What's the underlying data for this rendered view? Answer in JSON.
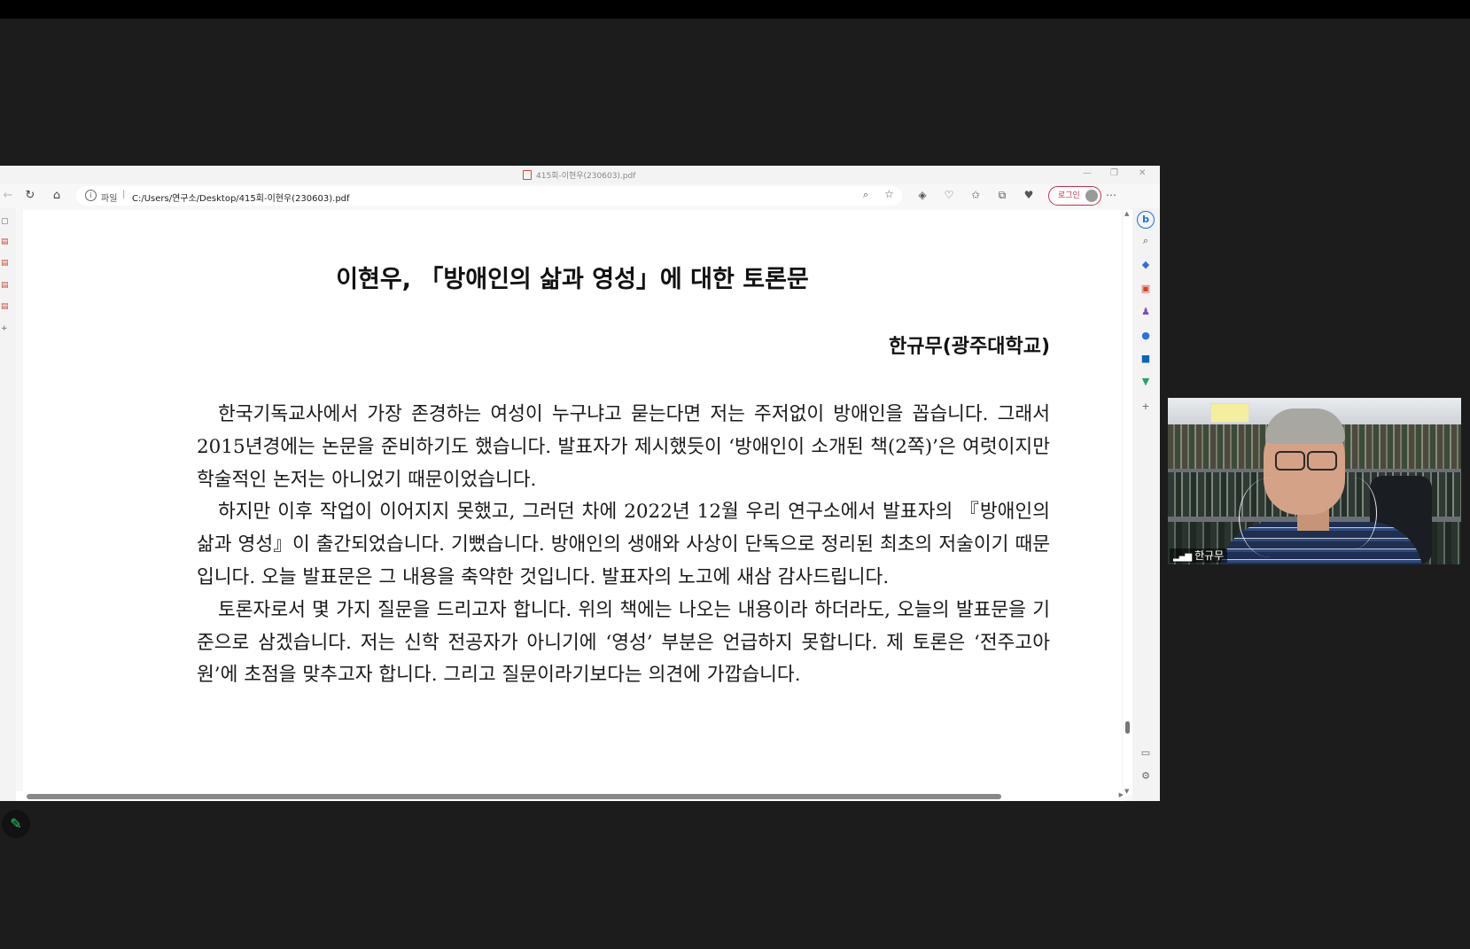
{
  "browser": {
    "tab_title": "415회-이현우(230603).pdf",
    "win_controls": {
      "minimize": "—",
      "restore": "❐",
      "close": "✕"
    },
    "address": {
      "scheme": "파일",
      "separator": "|",
      "url": "C:/Users/연구소/Desktop/415회-이현우(230603).pdf"
    },
    "login_label": "로그인"
  },
  "document": {
    "title": "이현우, 「방애인의 삶과 영성」에 대한 토론문",
    "author": "한규무(광주대학교)",
    "paragraphs": [
      "한국기독교사에서 가장 존경하는 여성이 누구냐고 묻는다면 저는 주저없이 방애인을 꼽습니다. 그래서 2015년경에는 논문을 준비하기도 했습니다. 발표자가 제시했듯이 ‘방애인이 소개된 책(2쪽)’은 여럿이지만 학술적인 논저는 아니었기 때문이었습니다.",
      "하지만 이후 작업이 이어지지 못했고, 그러던 차에 2022년 12월 우리 연구소에서 발표자의 『방애인의 삶과 영성』이 출간되었습니다. 기뻤습니다. 방애인의 생애와 사상이 단독으로 정리된 최초의 저술이기 때문입니다. 오늘 발표문은 그 내용을 축약한 것입니다. 발표자의 노고에 새삼 감사드립니다.",
      "토론자로서 몇 가지 질문을 드리고자 합니다. 위의 책에는 나오는 내용이라 하더라도, 오늘의 발표문을 기준으로 삼겠습니다. 저는 신학 전공자가 아니기에 ‘영성’ 부분은 언급하지 못합니다. 제 토론은 ‘전주고아원’에 초점을 맞추고자 합니다. 그리고 질문이라기보다는 의견에 가깝습니다."
    ]
  },
  "video": {
    "participant_name": "한규무"
  }
}
